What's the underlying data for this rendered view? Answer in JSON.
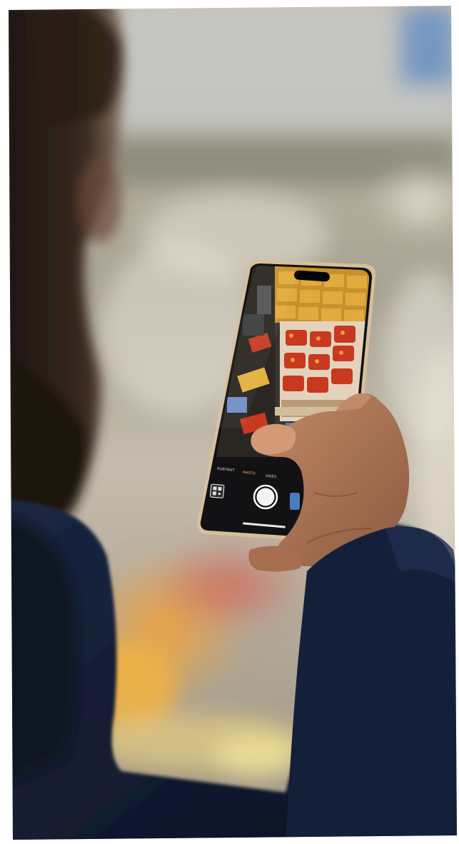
{
  "photo": {
    "subject": "person-holding-smartphone",
    "colors": {
      "frame": "#ffffff",
      "backdrop_top": "#b7b1a3",
      "backdrop_mid": "#c9c2b3",
      "shelf_warm": "#d9a25a",
      "jacket": "#17223a",
      "jacket_shadow": "#0b1222",
      "hair": "#1d1611",
      "skin": "#b27a5a",
      "phone_frame": "#d9c3a2",
      "tomato": "#c8391f",
      "crate": "#d8b98a",
      "shutter": "#f4f4f4"
    }
  },
  "camera_app": {
    "mode_labels": [
      "PORTRAIT",
      "PHOTO",
      "VIDEO"
    ],
    "selected_mode": "PHOTO",
    "shutter_icon": "shutter-button-icon",
    "scan_icon": "qr-scan-icon",
    "thumbnail_icon": "gallery-thumbnail-icon"
  }
}
